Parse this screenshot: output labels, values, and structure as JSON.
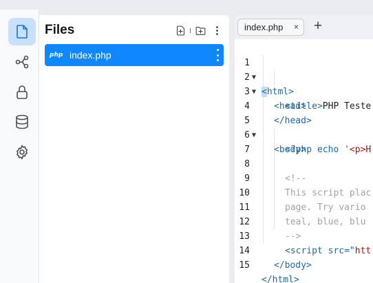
{
  "rail": {
    "items": [
      {
        "name": "files",
        "active": true
      },
      {
        "name": "git",
        "active": false
      },
      {
        "name": "lock",
        "active": false
      },
      {
        "name": "database",
        "active": false
      },
      {
        "name": "settings",
        "active": false
      }
    ]
  },
  "files_panel": {
    "title": "Files",
    "files": [
      {
        "type_badge": "php",
        "name": "index.php"
      }
    ]
  },
  "editor": {
    "tab_label": "index.php",
    "tab_close": "×",
    "add_tab": "+",
    "lines": [
      {
        "n": "1",
        "fold": "▼"
      },
      {
        "n": "2",
        "fold": "▼"
      },
      {
        "n": "3",
        "fold": ""
      },
      {
        "n": "4",
        "fold": ""
      },
      {
        "n": "5",
        "fold": "▼"
      },
      {
        "n": "6",
        "fold": ""
      },
      {
        "n": "7",
        "fold": ""
      },
      {
        "n": "8",
        "fold": ""
      },
      {
        "n": "9",
        "fold": ""
      },
      {
        "n": "10",
        "fold": ""
      },
      {
        "n": "11",
        "fold": ""
      },
      {
        "n": "12",
        "fold": ""
      },
      {
        "n": "13",
        "fold": ""
      },
      {
        "n": "14",
        "fold": ""
      },
      {
        "n": "15",
        "fold": ""
      }
    ],
    "code": {
      "l1_open": "<",
      "l1_rest": "html>",
      "l2": "<head>",
      "l3_tag": "<title>",
      "l3_text": "PHP Teste",
      "l4": "</head>",
      "l5": "<body>",
      "l6_a": "<?php echo '",
      "l6_b": "<p>H",
      "l8": "<!--",
      "l9": "This script plac",
      "l10": "page. Try vario",
      "l11": "teal, blue, blu",
      "l12": "-->",
      "l13_a": "<script src=\"",
      "l13_b": "htt",
      "l14": "</body>",
      "l15": "</html>"
    }
  }
}
